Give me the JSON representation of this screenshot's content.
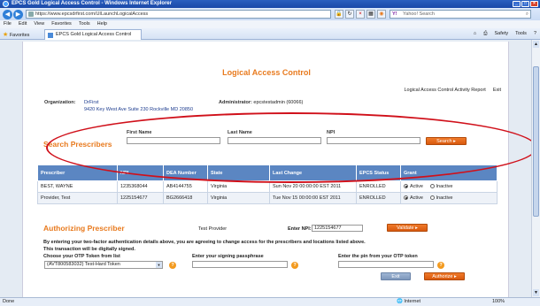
{
  "window": {
    "title": "EPCS Gold Logical Access Control - Windows Internet Explorer"
  },
  "browser": {
    "url": "https://www.epcsdrfirst.com/UILaunchLogicalAccess",
    "search_placeholder": "Yahoo! Search",
    "menu": [
      "File",
      "Edit",
      "View",
      "Favorites",
      "Tools",
      "Help"
    ],
    "favorites_label": "Favorites",
    "tab_title": "EPCS Gold Logical Access Control",
    "tools": [
      "Safety",
      "Tools"
    ],
    "status_left": "Done",
    "status_zone": "Internet",
    "status_zoom": "100%"
  },
  "page": {
    "title": "Logical Access Control",
    "links": [
      "Logical Access Control Activity Report",
      "Exit"
    ],
    "org_label": "Organization:",
    "org_name": "DrFirst",
    "org_address": "9420 Key West Ave Suite 230 Rockville MD 20850",
    "admin_label": "Administrator:",
    "admin_value": "epcstestadmin (60066)"
  },
  "search": {
    "title": "Search Prescribers",
    "first_name_label": "First Name",
    "last_name_label": "Last Name",
    "npi_label": "NPI",
    "button": "Search"
  },
  "table": {
    "headers": [
      "Prescriber",
      "NPI",
      "DEA Number",
      "State",
      "Last Change",
      "EPCS Status",
      "Grant"
    ],
    "rows": [
      {
        "prescriber": "BEST, WAYNE",
        "npi": "1235368044",
        "dea": "AB4144755",
        "state": "Virginia",
        "last_change": "Sun Nov 20 00:00:00 EST 2011",
        "status": "ENROLLED",
        "grant": "Active"
      },
      {
        "prescriber": "Provider, Test",
        "npi": "1225154677",
        "dea": "BG2666418",
        "state": "Virginia",
        "last_change": "Tue Nov 15 00:00:00 EST 2011",
        "status": "ENROLLED",
        "grant": "Active"
      }
    ],
    "grant_active": "Active",
    "grant_inactive": "Inactive"
  },
  "authorize": {
    "title": "Authorizing Prescriber",
    "prescriber_name": "Test Provider",
    "npi_label": "Enter NPI:",
    "npi_value": "1225154677",
    "validate_button": "Validate",
    "notice": "By entering your two-factor authentication details above, you are agreeing to change access for the prescribers and locations listed above.",
    "notice2": "This transaction will be digitally signed.",
    "otp_label": "Choose your OTP Token from list",
    "otp_value": "(AVT800583032) Test-Hard Token",
    "passphrase_label": "Enter your signing passphrase",
    "pin_label": "Enter the pin from your OTP token",
    "exit_button": "Exit",
    "authorize_button": "Authorize"
  }
}
